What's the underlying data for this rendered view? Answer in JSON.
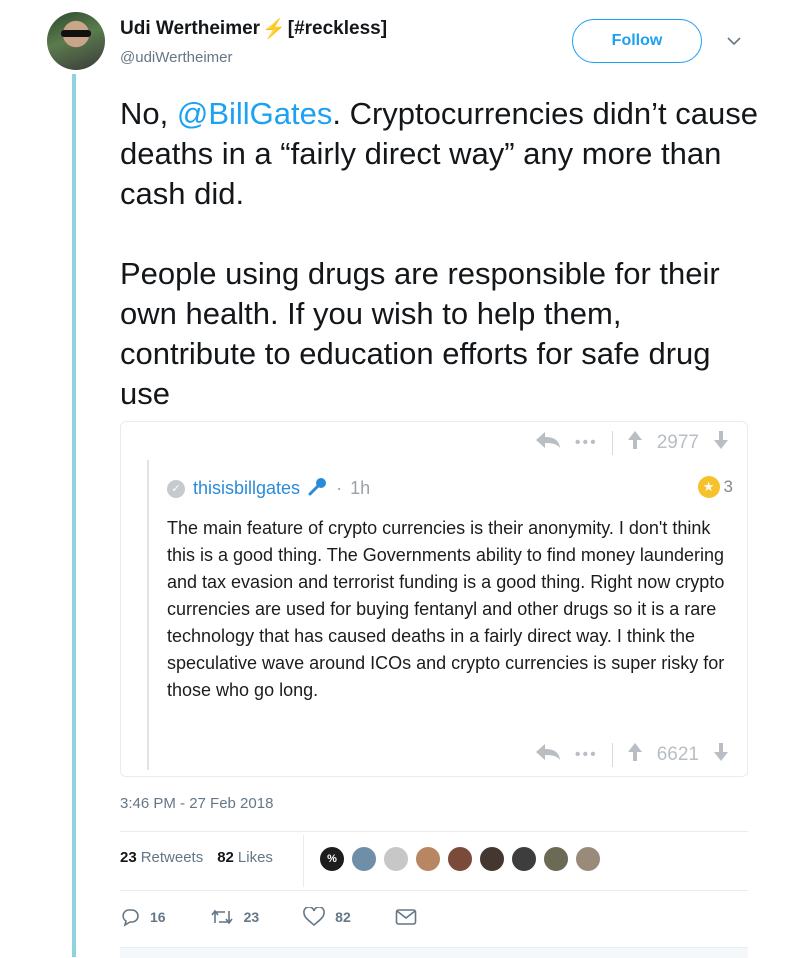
{
  "author": {
    "name": "Udi Wertheimer",
    "name_suffix": "[#reckless]",
    "handle": "@udiWertheimer",
    "follow_label": "Follow"
  },
  "tweet": {
    "para1_prefix": "No, ",
    "mention": "@BillGates",
    "para1_rest": ". Cryptocurrencies didn’t cause deaths in a “fairly direct way” any more than cash did.",
    "para2": "People using drugs are responsible for their own health. If you wish to help them, contribute to education efforts for safe drug use"
  },
  "embed": {
    "top_score": "2977",
    "bottom_score": "6621",
    "username": "thisisbillgates",
    "time_ago": "1h",
    "award_count": "3",
    "body": "The main feature of crypto currencies is their anonymity. I don't think this is a good thing. The Governments ability to find money laundering and tax evasion and terrorist funding is a good thing. Right now crypto currencies are used for buying fentanyl and other drugs so it is a rare technology that has caused deaths in a fairly direct way. I think the speculative wave around ICOs and crypto currencies is super risky for those who go long."
  },
  "timestamp": "3:46 PM - 27 Feb 2018",
  "stats": {
    "retweets_count": "23",
    "retweets_label": "Retweets",
    "likes_count": "82",
    "likes_label": "Likes"
  },
  "likers": [
    "#1d1d1d",
    "#6f8fa8",
    "#c7c7c7",
    "#b98663",
    "#7a4a3a",
    "#44372f",
    "#3d3d3d",
    "#6a6a55",
    "#9a8a7a"
  ],
  "actions": {
    "reply_count": "16",
    "retweet_count": "23",
    "like_count": "82"
  },
  "colors": {
    "accent": "#1da1f2",
    "thread_line": "#8fd3df",
    "bolt": "#f4b400"
  }
}
